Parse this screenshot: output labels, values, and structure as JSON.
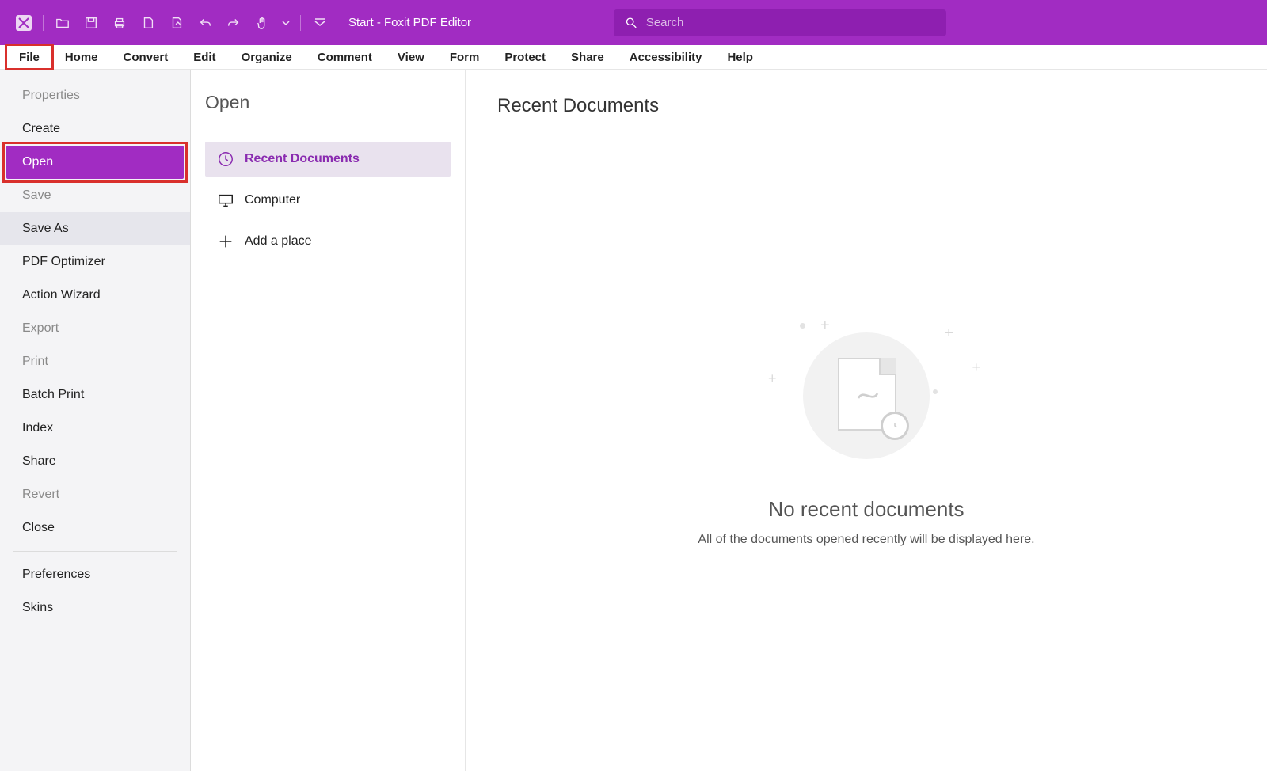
{
  "titlebar": {
    "title": "Start - Foxit PDF Editor",
    "search_placeholder": "Search"
  },
  "ribbon": [
    "File",
    "Home",
    "Convert",
    "Edit",
    "Organize",
    "Comment",
    "View",
    "Form",
    "Protect",
    "Share",
    "Accessibility",
    "Help"
  ],
  "file_menu": {
    "properties": "Properties",
    "create": "Create",
    "open": "Open",
    "save": "Save",
    "save_as": "Save As",
    "pdf_optimizer": "PDF Optimizer",
    "action_wizard": "Action Wizard",
    "export": "Export",
    "print": "Print",
    "batch_print": "Batch Print",
    "index": "Index",
    "share": "Share",
    "revert": "Revert",
    "close": "Close",
    "preferences": "Preferences",
    "skins": "Skins"
  },
  "open_panel": {
    "title": "Open",
    "recent": "Recent Documents",
    "computer": "Computer",
    "add_place": "Add a place"
  },
  "content": {
    "title": "Recent Documents",
    "empty_title": "No recent documents",
    "empty_sub": "All of the documents opened recently will be displayed here."
  }
}
